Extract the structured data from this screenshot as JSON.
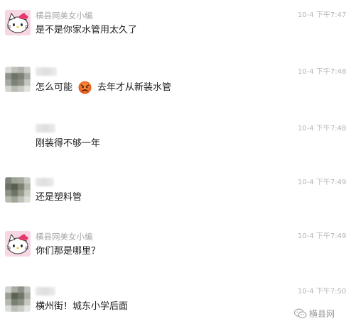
{
  "messages": [
    {
      "sender": "横县网美女小编",
      "avatar_icon": "hello-kitty-avatar",
      "time": "10-4 下午7:47",
      "text": "是不是你家水管用太久了"
    },
    {
      "sender": "",
      "avatar_icon": "pixelated-avatar",
      "time": "10-4 下午7:48",
      "text_before": "怎么可能",
      "emoji_icon": "angry-face-emoji",
      "text_after": "去年才从新装水管"
    },
    {
      "sender": "",
      "avatar_icon": "",
      "time": "10-4 下午7:48",
      "text": "刚装得不够一年"
    },
    {
      "sender": "",
      "avatar_icon": "pixelated-avatar",
      "time": "10-4 下午7:49",
      "text": "还是塑料管"
    },
    {
      "sender": "横县网美女小编",
      "avatar_icon": "hello-kitty-avatar",
      "time": "10-4 下午7:49",
      "text": "你们那是哪里？"
    },
    {
      "sender": "",
      "avatar_icon": "pixelated-avatar",
      "time": "10-4 下午7:50",
      "text": "横州街！城东小学后面"
    }
  ],
  "watermark": {
    "icon": "wechat-icon",
    "label": "横县网"
  },
  "colors": {
    "sender": "#a7a7a7",
    "time": "#b4b4b4",
    "text": "#202020",
    "background": "#ffffff"
  }
}
